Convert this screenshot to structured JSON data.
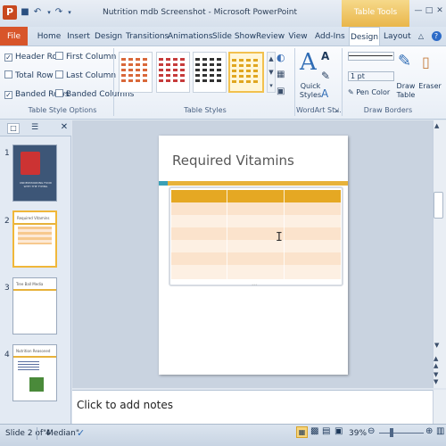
{
  "window": {
    "title": "Nutrition mdb Screenshot - Microsoft PowerPoint",
    "app_icon_letter": "P",
    "contextual_tab_group": "Table Tools"
  },
  "tabs": [
    "File",
    "Home",
    "Insert",
    "Design",
    "Transitions",
    "Animations",
    "Slide Show",
    "Review",
    "View",
    "Add-Ins",
    "Design",
    "Layout"
  ],
  "ribbon": {
    "table_style_options": {
      "label": "Table Style Options",
      "options": [
        {
          "label": "Header Row",
          "checked": true
        },
        {
          "label": "First Column",
          "checked": false
        },
        {
          "label": "Total Row",
          "checked": false
        },
        {
          "label": "Last Column",
          "checked": false
        },
        {
          "label": "Banded Rows",
          "checked": true
        },
        {
          "label": "Banded Columns",
          "checked": false
        }
      ]
    },
    "table_styles": {
      "label": "Table Styles"
    },
    "wordart": {
      "label": "WordArt St...",
      "quick_styles": "Quick Styles"
    },
    "draw_borders": {
      "label": "Draw Borders",
      "pen_weight": "1 pt",
      "pen_color": "Pen Color",
      "draw_table": "Draw Table",
      "eraser": "Eraser"
    }
  },
  "slides": [
    {
      "num": "1",
      "caption": "UNDERSTANDING FOOD WITH THE TYPING"
    },
    {
      "num": "2",
      "caption": "Required Vitamins"
    },
    {
      "num": "3",
      "caption": "Tree Ball Media"
    },
    {
      "num": "4",
      "caption": "Nutrition Reasoned"
    }
  ],
  "editor": {
    "slide_title": "Required Vitamins",
    "notes_placeholder": "Click to add notes"
  },
  "status": {
    "slide_info": "Slide 2 of 4",
    "theme": "\"Median\"",
    "zoom": "39%"
  },
  "colors": {
    "accent": "#e7b23a",
    "file_tab": "#d8552a",
    "header_row": "#e5a823",
    "band_light": "#fce7d4",
    "band_mid": "#f9d9bb"
  }
}
